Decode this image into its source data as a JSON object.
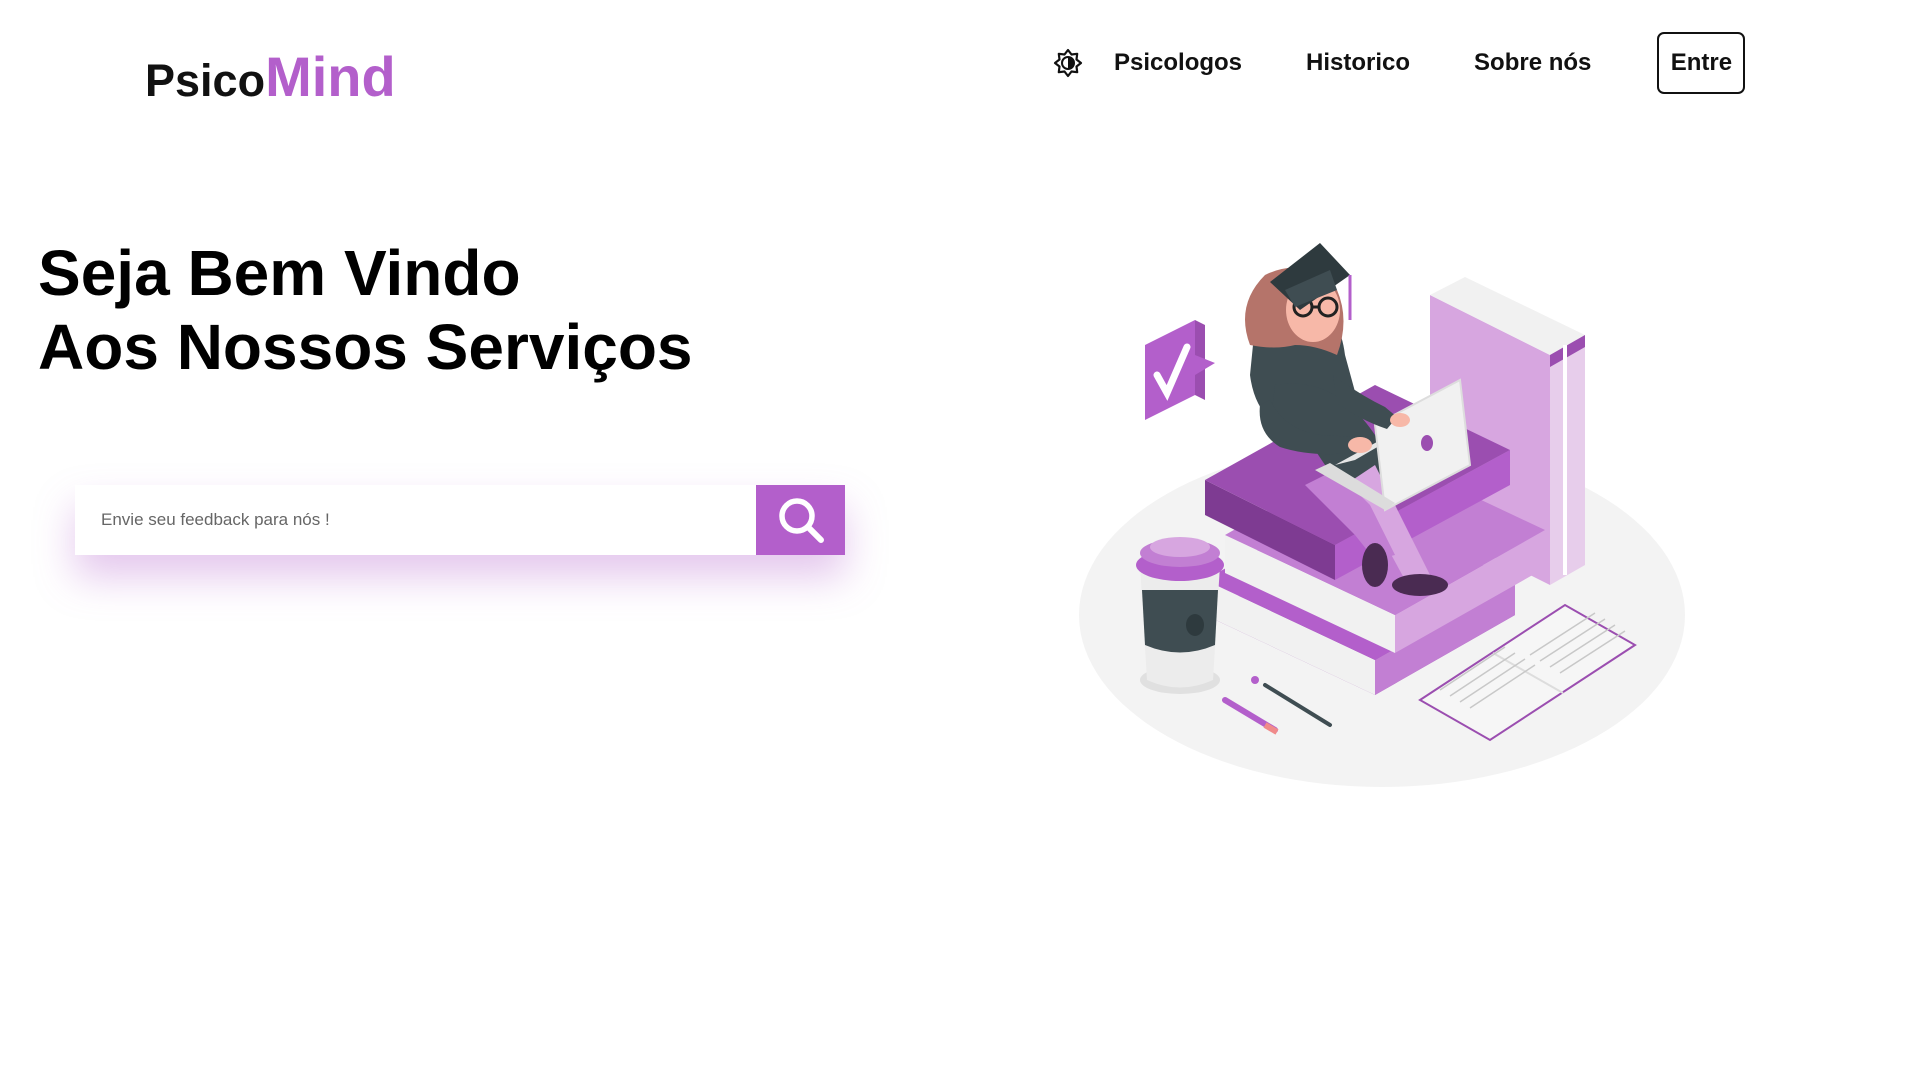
{
  "logo": {
    "part1": "Psico",
    "part2": "Mind",
    "accent_color": "#b35fcb"
  },
  "nav": {
    "theme_toggle_icon": "brightness-icon",
    "links": [
      "Psicologos",
      "Historico",
      "Sobre nós"
    ],
    "login_label": "Entre"
  },
  "hero": {
    "title_line1": "Seja Bem Vindo",
    "title_line2": "Aos Nossos Serviços"
  },
  "search": {
    "placeholder": "Envie seu feedback para nós !",
    "value": "",
    "button_icon": "search-icon"
  },
  "illustration": {
    "icon": "student-graduate-illustration"
  }
}
